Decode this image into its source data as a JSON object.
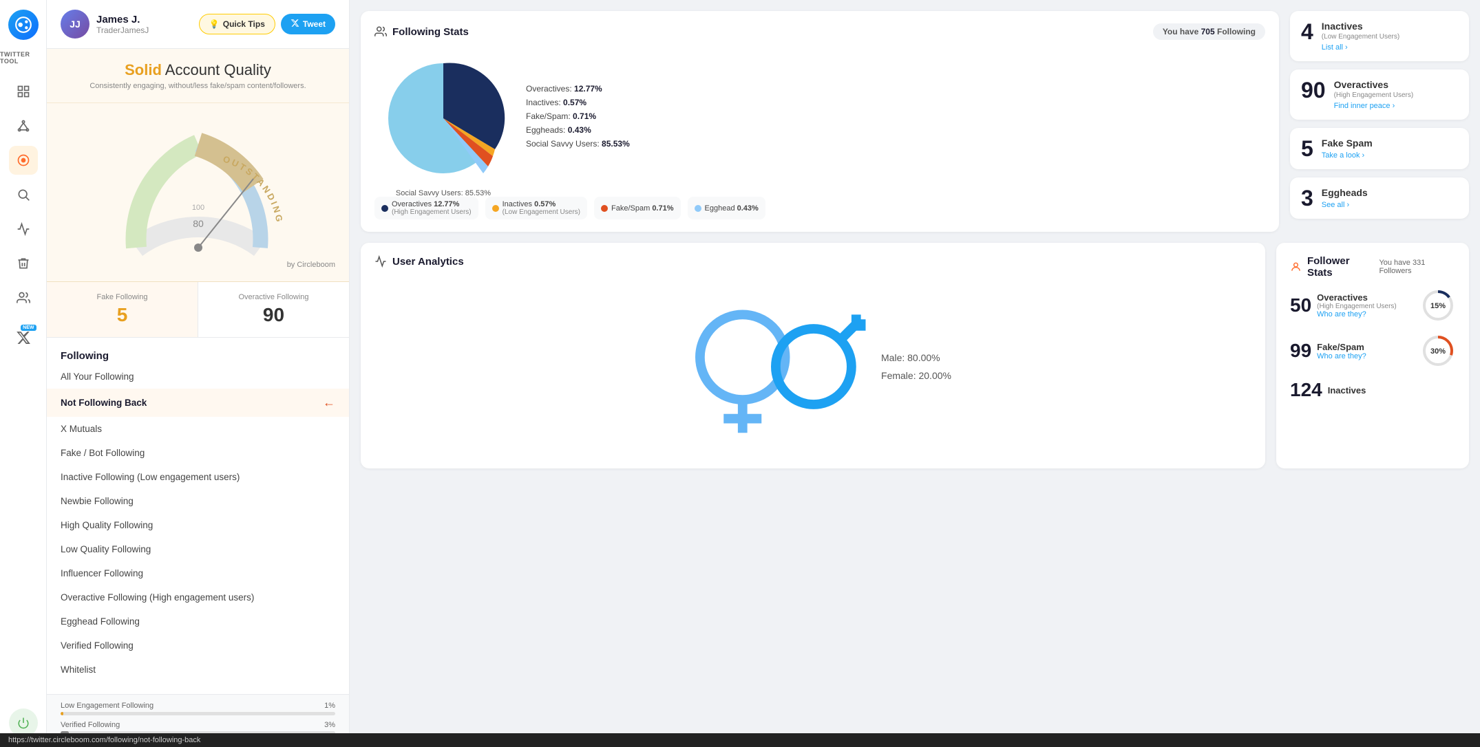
{
  "app": {
    "name": "TWITTER TOOL"
  },
  "header": {
    "user_name": "James J.",
    "user_handle": "TraderJamesJ",
    "quick_tips_label": "Quick Tips",
    "tweet_label": "Tweet"
  },
  "quality": {
    "solid": "Solid",
    "account_quality": "Account Quality",
    "subtitle": "Consistently engaging, without/less fake/spam content/followers."
  },
  "stats": {
    "fake_following_label": "Fake Following",
    "fake_following_value": "5",
    "overactive_following_label": "Overactive Following",
    "overactive_following_value": "90"
  },
  "nav": {
    "section_title": "Following",
    "items": [
      {
        "label": "All Your Following",
        "active": false
      },
      {
        "label": "Not Following Back",
        "active": true
      },
      {
        "label": "X Mutuals",
        "active": false
      },
      {
        "label": "Fake / Bot Following",
        "active": false
      },
      {
        "label": "Inactive Following (Low engagement users)",
        "active": false
      },
      {
        "label": "Newbie Following",
        "active": false
      },
      {
        "label": "High Quality Following",
        "active": false
      },
      {
        "label": "Low Quality Following",
        "active": false
      },
      {
        "label": "Influencer Following",
        "active": false
      },
      {
        "label": "Overactive Following (High engagement users)",
        "active": false
      },
      {
        "label": "Egghead Following",
        "active": false
      },
      {
        "label": "Verified Following",
        "active": false
      },
      {
        "label": "Whitelist",
        "active": false
      }
    ]
  },
  "progress_bars": [
    {
      "label": "Low Engagement Following",
      "percent": "1%",
      "value": 1,
      "color": "#e8a020"
    },
    {
      "label": "Verified Following",
      "percent": "3%",
      "value": 3,
      "color": "#888"
    }
  ],
  "following_stats": {
    "title": "Following Stats",
    "you_have_label": "You have",
    "following_count": "705",
    "following_word": "Following",
    "pie": {
      "overactives_pct": 12.77,
      "inactives_pct": 0.57,
      "fake_spam_pct": 0.71,
      "eggheads_pct": 0.43,
      "social_savvy_pct": 85.53
    },
    "legend": [
      {
        "label": "Overactives: 12.77%",
        "color": "#1a2e5e"
      },
      {
        "label": "Inactives: 0.57%",
        "color": "#f5a623"
      },
      {
        "label": "Fake/Spam: 0.71%",
        "color": "#e05020"
      },
      {
        "label": "Eggheads: 0.43%",
        "color": "#64b5f6"
      }
    ],
    "social_savvy_label": "Social Savvy Users: 85.53%",
    "pills": [
      {
        "label": "Overactives 12.77%",
        "sublabel": "(High Engagement Users)",
        "color": "#1a2e5e"
      },
      {
        "label": "Inactives 0.57%",
        "sublabel": "(Low Engagement Users)",
        "color": "#f5a623"
      },
      {
        "label": "Fake/Spam 0.71%",
        "color": "#e05020"
      },
      {
        "label": "Egghead 0.43%",
        "color": "#64b5f6"
      }
    ]
  },
  "right_stats": {
    "inactives": {
      "num": "4",
      "label": "Inactives",
      "sub": "(Low Engagement Users)",
      "link": "List all ›"
    },
    "overactives": {
      "num": "90",
      "label": "Overactives",
      "sub": "(High Engagement Users)",
      "link": "Find inner peace ›"
    },
    "fake_spam": {
      "num": "5",
      "label": "Fake Spam",
      "link": "Take a look ›"
    },
    "eggheads": {
      "num": "3",
      "label": "Eggheads",
      "link": "See all ›"
    }
  },
  "user_analytics": {
    "title": "User Analytics",
    "male_pct": "Male: 80.00%",
    "female_pct": "Female: 20.00%"
  },
  "follower_stats": {
    "title": "Follower Stats",
    "you_have_label": "You have 331 Followers",
    "overactives": {
      "num": "50",
      "label": "Overactives",
      "sub": "(High Engagement Users)",
      "link": "Who are they?",
      "pct": "15%",
      "color": "#1a2e5e"
    },
    "fake_spam": {
      "num": "99",
      "label": "Fake/Spam",
      "link": "Who are they?",
      "pct": "30%",
      "color": "#e05020"
    },
    "inactives": {
      "num": "124",
      "label": "Inactives"
    }
  },
  "url_bar": "https://twitter.circleboom.com/following/not-following-back"
}
